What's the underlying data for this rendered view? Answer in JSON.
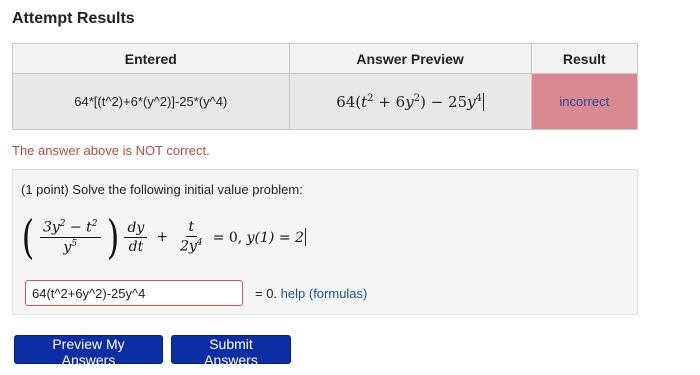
{
  "page": {
    "title": "Attempt Results"
  },
  "results_table": {
    "headers": {
      "entered": "Entered",
      "preview": "Answer Preview",
      "result": "Result"
    },
    "row": {
      "entered": "64*[(t^2)+6*(y^2)]-25*(y^4)",
      "result": "incorrect"
    }
  },
  "feedback": {
    "message": "The answer above is NOT correct."
  },
  "problem": {
    "prompt": "(1 point) Solve the following initial value problem:",
    "equation_tail": "= 0,",
    "initial_condition": "y(1) = 2"
  },
  "answer": {
    "value": "64(t^2+6y^2)-25y^4",
    "suffix": "= 0.",
    "help_link": "help (formulas)"
  },
  "buttons": {
    "preview": "Preview My Answers",
    "submit": "Submit Answers"
  },
  "colors": {
    "incorrect_bg": "#d9898f",
    "button_bg": "#0c2ea5",
    "link": "#1f4f9e",
    "error_text": "#b94a48"
  }
}
